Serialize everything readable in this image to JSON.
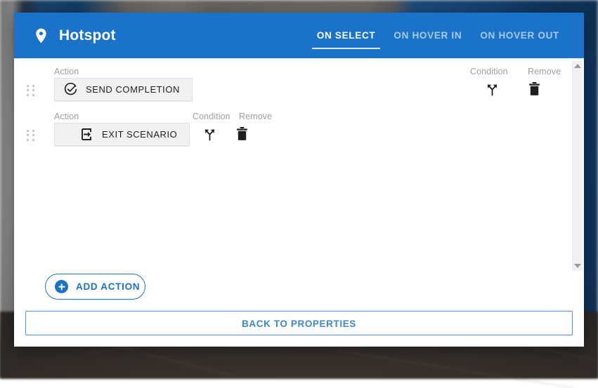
{
  "background": {
    "description": "blurred-room-photo"
  },
  "dialog": {
    "header": {
      "icon": "location-pin-icon",
      "title": "Hotspot",
      "accent_color": "#1a73c8",
      "tabs": [
        {
          "label": "ON SELECT",
          "active": true
        },
        {
          "label": "ON HOVER IN",
          "active": false
        },
        {
          "label": "ON HOVER OUT",
          "active": false
        }
      ]
    },
    "columns": {
      "action": "Action",
      "condition": "Condition",
      "remove": "Remove"
    },
    "action_rows": [
      {
        "drag_handle": "drag-handle-icon",
        "action_label": "Action",
        "action_icon": "check-circle-icon",
        "action_name": "SEND COMPLETION",
        "condition_label": "Condition",
        "condition_icon": "branch-fork-icon",
        "remove_label": "Remove",
        "remove_icon": "trash-icon"
      },
      {
        "drag_handle": "drag-handle-icon",
        "action_label": "Action",
        "action_icon": "exit-door-icon",
        "action_name": "EXIT SCENARIO",
        "condition_label": "Condition",
        "condition_icon": "branch-fork-icon",
        "remove_label": "Remove",
        "remove_icon": "trash-icon"
      }
    ],
    "scrollbar": {
      "up_arrow": "chevron-up-icon",
      "down_arrow": "chevron-down-icon"
    },
    "footer": {
      "add_action_label": "ADD ACTION",
      "add_action_icon": "plus-circle-icon",
      "back_label": "BACK TO PROPERTIES"
    }
  }
}
